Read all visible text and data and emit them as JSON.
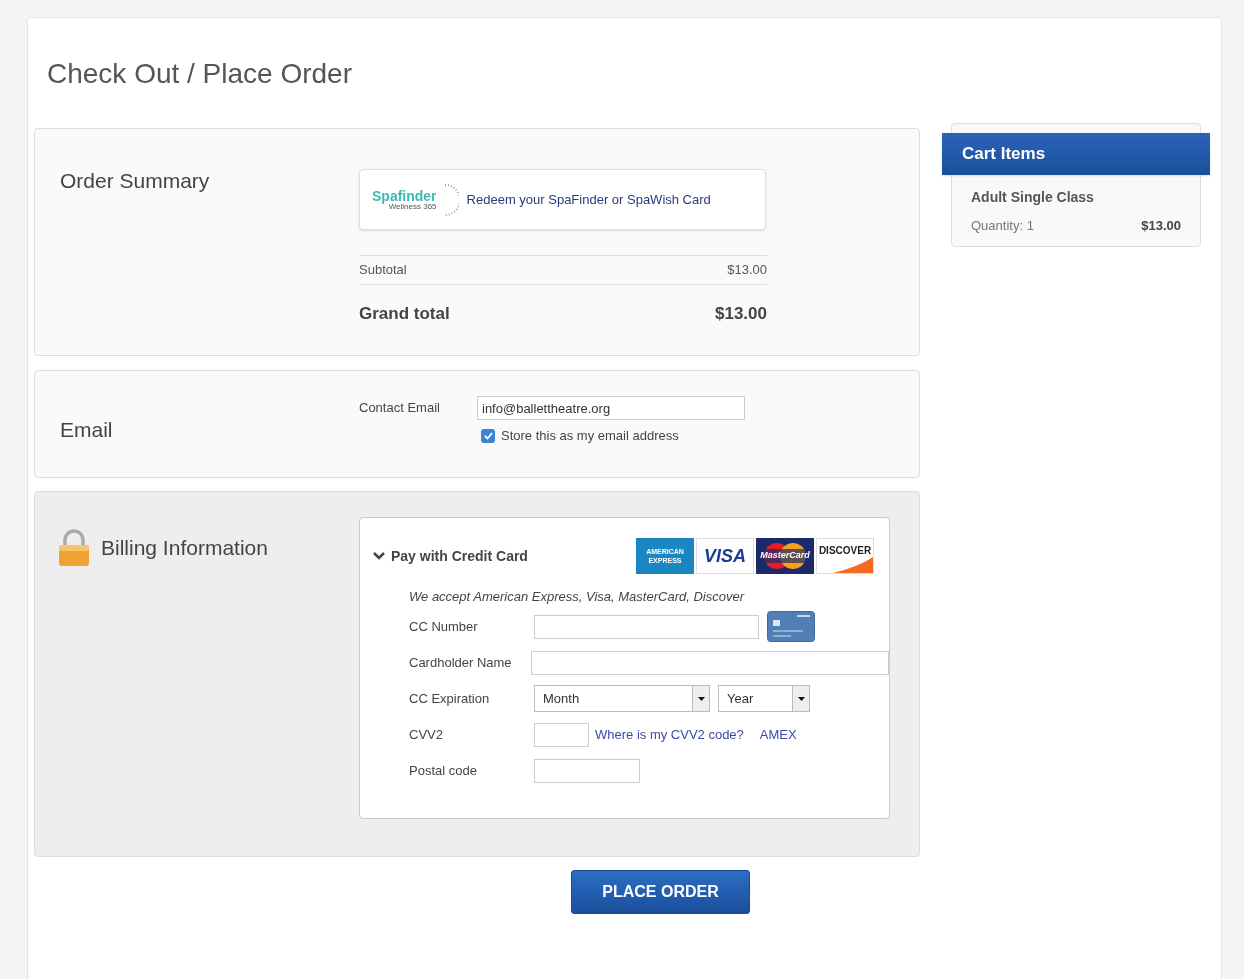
{
  "page_title": "Check Out / Place Order",
  "order_summary": {
    "heading": "Order Summary",
    "redeem": {
      "logo_name": "Spafinder",
      "logo_tagline": "Wellness 365",
      "label": "Redeem your SpaFinder or SpaWish Card"
    },
    "subtotal_label": "Subtotal",
    "subtotal": "$13.00",
    "grand_total_label": "Grand total",
    "grand_total": "$13.00"
  },
  "email": {
    "heading": "Email",
    "field_label": "Contact Email",
    "value": "info@ballettheatre.org",
    "store": {
      "label": "Store this as my email address",
      "checked": true
    }
  },
  "billing": {
    "heading": "Billing Information",
    "method": {
      "label": "Pay with Credit Card",
      "expanded": true
    },
    "cards": [
      {
        "kind": "amex",
        "label": "AMERICAN EXPRESS"
      },
      {
        "kind": "visa",
        "label": "VISA"
      },
      {
        "kind": "mastercard",
        "label": "MasterCard"
      },
      {
        "kind": "discover",
        "label": "DISCOVER"
      }
    ],
    "accepted": "We accept American Express, Visa, MasterCard, Discover",
    "fields": [
      {
        "kind": "cardnumber",
        "label": "CC Number"
      },
      {
        "kind": "name",
        "label": "Cardholder Name"
      },
      {
        "kind": "expiration",
        "label": "CC Expiration",
        "month": "Month",
        "year": "Year"
      },
      {
        "kind": "cvv",
        "label": "CVV2",
        "links": [
          "Where is my CVV2 code?",
          "AMEX"
        ]
      },
      {
        "kind": "postal",
        "label": "Postal code"
      }
    ]
  },
  "place_order": "PLACE ORDER",
  "cart": {
    "title": "Cart Items",
    "items": [
      {
        "name": "Adult Single Class",
        "quantity": "Quantity: 1",
        "price": "$13.00"
      }
    ]
  }
}
